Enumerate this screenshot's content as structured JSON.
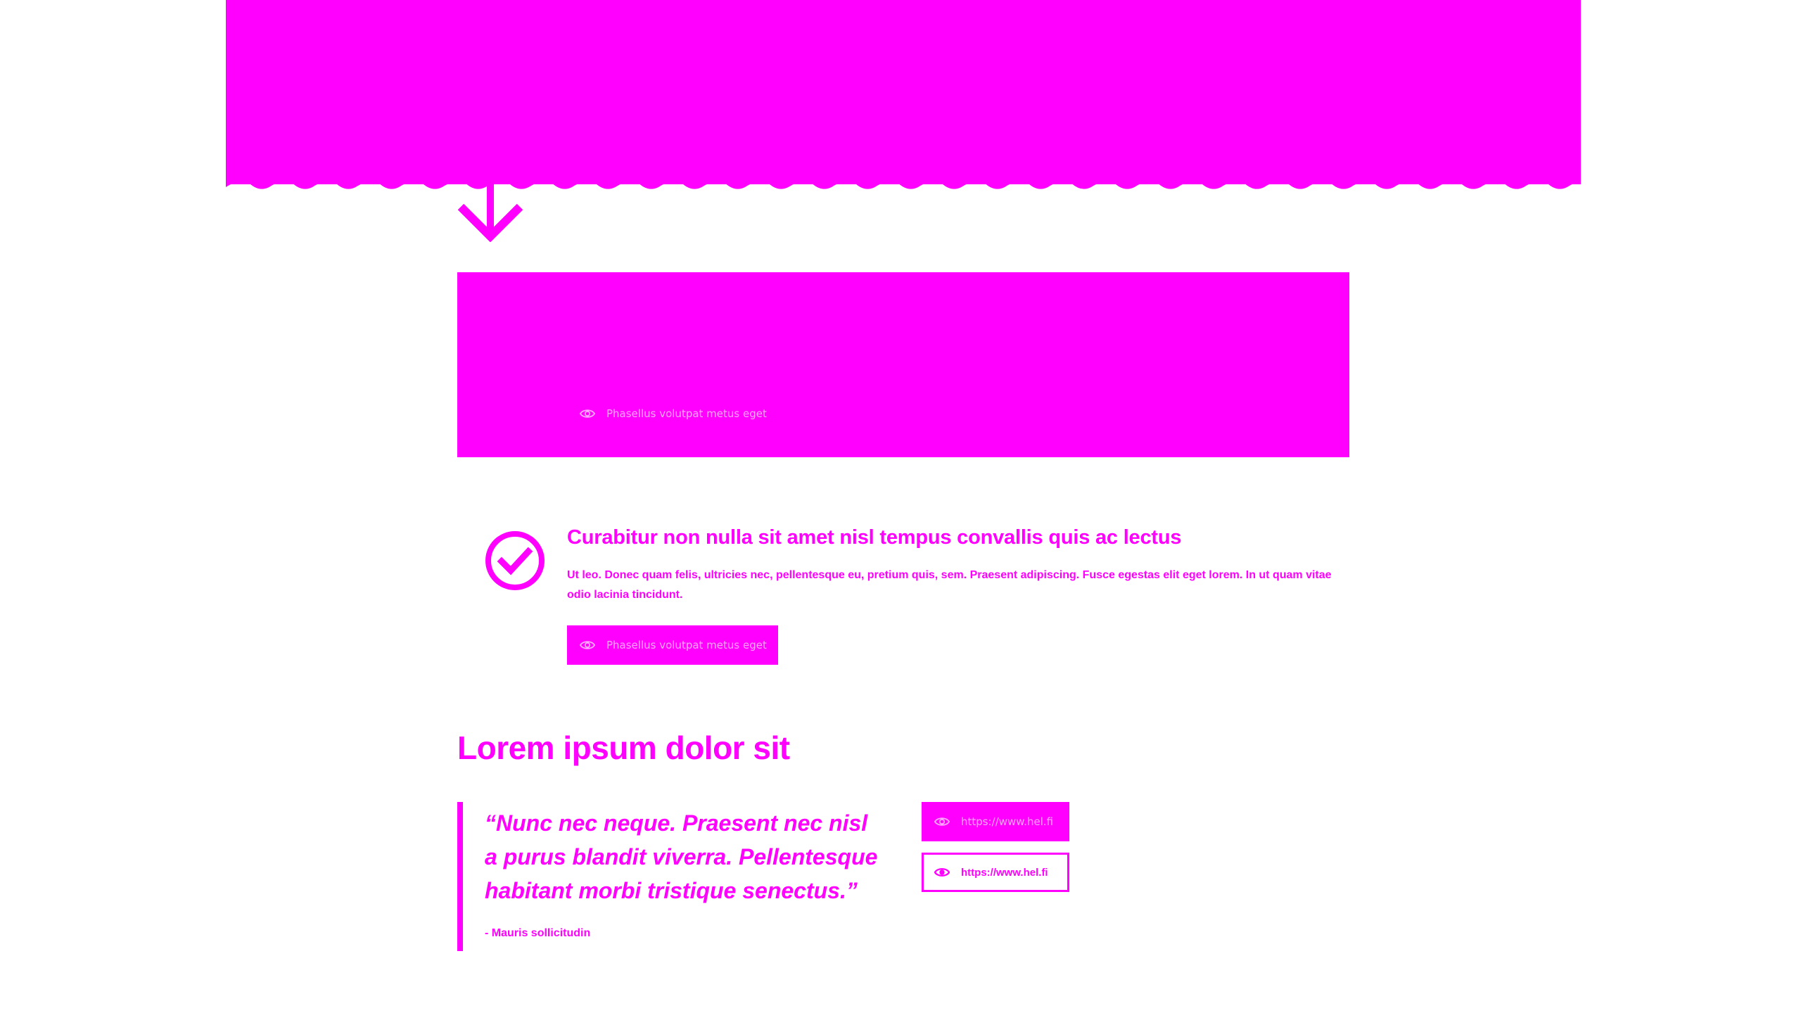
{
  "hero": {
    "title": "",
    "background_color": "#ff00ff"
  },
  "colors": {
    "accent": "#ff00ff",
    "background": "#ffffff"
  },
  "icons": {
    "down_arrow": "arrow-down-icon",
    "eye": "eye-icon",
    "check": "check-circle-icon"
  },
  "feature": {
    "link_label": "Phasellus volutpat metus eget"
  },
  "check_section": {
    "title": "Curabitur non nulla sit amet nisl tempus convallis quis ac lectus",
    "body": "Ut leo. Donec quam felis, ultricies nec, pellentesque eu, pretium quis, sem. Praesent adipiscing. Fusce egestas elit eget lorem. In ut quam vitae odio lacinia tincidunt.",
    "button_label": "Phasellus volutpat metus eget"
  },
  "section": {
    "heading": "Lorem ipsum dolor sit"
  },
  "quote": {
    "text": "“Nunc nec neque. Praesent nec nisl a purus blandit viverra. Pellentesque habitant morbi tristique senectus.”",
    "author": "- Mauris sollicitudin"
  },
  "links": {
    "filled_label": "https://www.hel.fi",
    "outline_label": "https://www.hel.fi"
  }
}
